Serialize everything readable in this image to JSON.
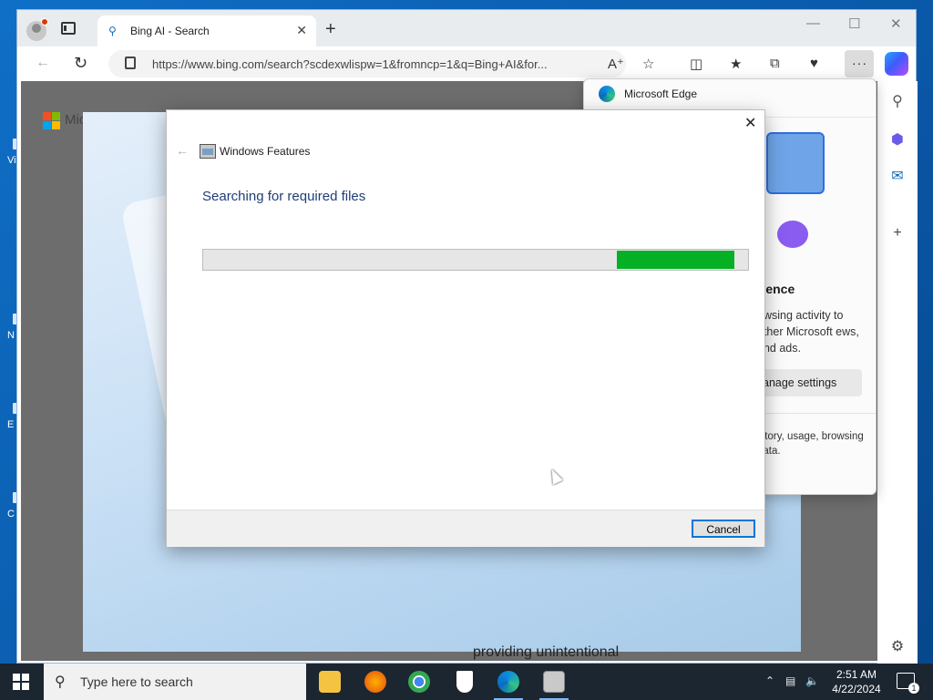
{
  "browser": {
    "tab": {
      "title": "Bing AI - Search"
    },
    "address_bar": {
      "url": "https://www.bing.com/search?scdexwlispw=1&fromncp=1&q=Bing+AI&for..."
    }
  },
  "page": {
    "logo_text": "Mic",
    "bottom_text": "providing unintentional"
  },
  "flyout": {
    "title": "Microsoft Edge",
    "heading": "rience",
    "body": "owsing activity to other Microsoft ews, and ads.",
    "manage_button": "anage settings",
    "footer": "istory, usage, browsing data."
  },
  "dialog": {
    "title": "Windows Features",
    "heading": "Searching for required files",
    "progress_start": 0.76,
    "progress_end": 0.975,
    "cancel_label": "Cancel"
  },
  "taskbar": {
    "search_placeholder": "Type here to search",
    "time": "2:51 AM",
    "date": "4/22/2024",
    "notification_count": "1"
  },
  "desktop_icon_labels": [
    "Vis",
    "N",
    "E",
    "C"
  ],
  "colors": {
    "progress_fill": "#06b025",
    "heading_blue": "#1f3d7a",
    "taskbar": "#1c2631"
  }
}
